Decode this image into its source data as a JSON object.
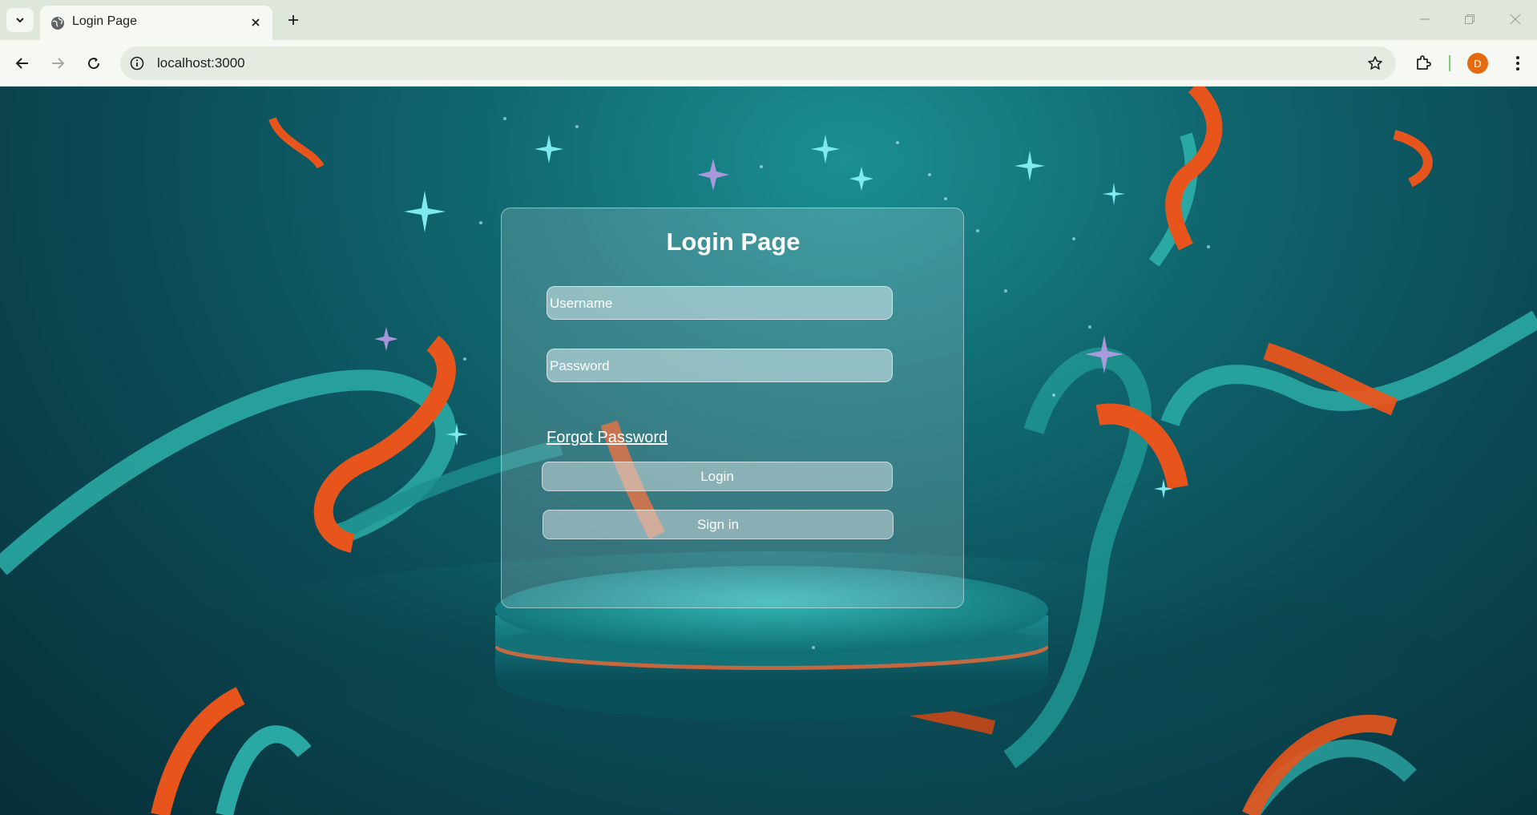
{
  "browser": {
    "tab": {
      "title": "Login Page"
    },
    "address_bar": {
      "url": "localhost:3000"
    },
    "profile_initial": "D",
    "icons": [
      "tab-search-icon",
      "globe-icon",
      "close-icon",
      "plus-icon",
      "minimize-icon",
      "restore-icon",
      "window-close-icon",
      "back-icon",
      "forward-icon",
      "reload-icon",
      "info-icon",
      "star-icon",
      "puzzle-icon",
      "kebab-menu-icon"
    ]
  },
  "login": {
    "title": "Login Page",
    "username_placeholder": "Username",
    "password_placeholder": "Password",
    "forgot_password": "Forgot Password",
    "login_button": "Login",
    "signin_button": "Sign in"
  },
  "colors": {
    "background_teal": "#10676f",
    "ribbon_orange": "#e8551c",
    "ribbon_teal": "#2aa8a3",
    "avatar": "#e56a10"
  }
}
